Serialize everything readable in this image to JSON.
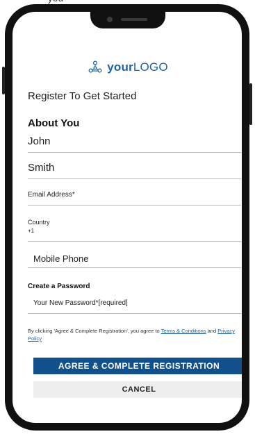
{
  "top_crop_text": "you",
  "logo": {
    "brand_bold": "your",
    "brand_light": "LOGO",
    "icon": "network-icon"
  },
  "form": {
    "title": "Register To Get Started",
    "section_about": "About You",
    "first_name": "John",
    "last_name": "Smith",
    "email_label": "Email Address*",
    "country_label": "Country",
    "country_code": "+1",
    "mobile_placeholder": "Mobile Phone",
    "password_section": "Create a Password",
    "password_placeholder": "Your New Password*[required]"
  },
  "terms": {
    "prefix": "By clicking 'Agree & Complete Registration', you agree to ",
    "terms_link": "Terms & Conditions",
    "middle": " and ",
    "privacy_link": "Privacy Policy"
  },
  "buttons": {
    "agree": "AGREE & COMPLETE REGISTRATION",
    "cancel": "CANCEL"
  },
  "colors": {
    "accent": "#1d63a6",
    "primary_button": "#12508c",
    "secondary_button": "#eeeeee",
    "phone_frame": "#111111"
  }
}
